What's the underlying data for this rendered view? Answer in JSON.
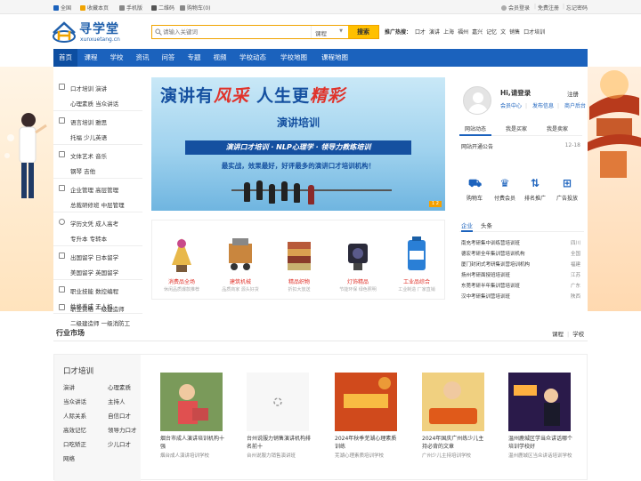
{
  "topbar": {
    "left": [
      "全国",
      "收藏本页",
      "手机版",
      "二维码",
      "购物车(0)"
    ],
    "right": [
      "会员登录",
      "免费注册",
      "忘记密码"
    ]
  },
  "logo": {
    "name": "寻学堂",
    "domain": "xunxuetang.cn"
  },
  "search": {
    "placeholder": "请输入关键词",
    "scope": "课程",
    "button": "搜索"
  },
  "hot": {
    "label": "推广热搜：",
    "items": [
      "口才",
      "演讲",
      "上海",
      "福州",
      "嘉兴",
      "记忆",
      "文",
      "销售",
      "口才培训"
    ]
  },
  "nav": [
    "首页",
    "课程",
    "学校",
    "资讯",
    "问答",
    "专题",
    "视频",
    "学校动态",
    "学校地图",
    "课程地图"
  ],
  "categories": [
    {
      "l1": "口才培训 演讲",
      "l2": "心理素质 当众讲话"
    },
    {
      "l1": "语言培训 雅思",
      "l2": "托福 少儿英语"
    },
    {
      "l1": "文体艺术 音乐",
      "l2": "钢琴 吉他"
    },
    {
      "l1": "企业管理 高层管理",
      "l2": "总裁研修班 中层管理"
    },
    {
      "l1": "学历文凭 成人高考",
      "l2": "专升本 专转本"
    },
    {
      "l1": "出国留学 日本留学",
      "l2": "美国留学 英国留学"
    },
    {
      "l1": "职业技能 数控编程",
      "l2": "性格养成 无人机"
    },
    {
      "l1": "职业资格 一级建造师",
      "l2": "二级建造师 一级消防工"
    }
  ],
  "banner": {
    "title_a": "演讲有",
    "title_b": "风采",
    "title_c": "人生更",
    "title_d": "精彩",
    "subtitle": "演讲培训",
    "strip": "演讲口才培训 · NLP心理学 · 领导力教练培训",
    "line": "最实战，效果最好，好评最多的演讲口才培训机构！",
    "pager": "1 2"
  },
  "ads": [
    {
      "title": "消费品全场",
      "sub": "休闲品质爆款推荐",
      "color": "#e8b84a"
    },
    {
      "title": "建筑机械",
      "sub": "品质商家 源头好货",
      "color": "#c9863e"
    },
    {
      "title": "精品织物",
      "sub": "折扣大放送",
      "color": "#b85a3a"
    },
    {
      "title": "灯饰精品",
      "sub": "节能环保 绿色照明",
      "color": "#2a2a3a"
    },
    {
      "title": "工业品综合",
      "sub": "工业制造 厂家直销",
      "color": "#2a7fd6"
    }
  ],
  "user": {
    "greet": "Hi,请登录",
    "register": "注册",
    "links": [
      "会员中心",
      "发布信息",
      "商户后台"
    ],
    "tabs": [
      "网站动态",
      "我是买家",
      "我是卖家"
    ],
    "notice": {
      "text": "网站开通公告",
      "date": "12-18"
    },
    "icons": [
      {
        "label": "购物车",
        "icon": "cart-icon",
        "glyph": "⛟"
      },
      {
        "label": "付费会员",
        "icon": "vip-icon",
        "glyph": "♛"
      },
      {
        "label": "排名推广",
        "icon": "rank-icon",
        "glyph": "⇅"
      },
      {
        "label": "广告投放",
        "icon": "ad-icon",
        "glyph": "⊞"
      }
    ]
  },
  "news": {
    "tabs": [
      "企业",
      "头条"
    ],
    "rows": [
      {
        "name": "南充考研集中训练营培训班",
        "region": "四川"
      },
      {
        "name": "德宏考研全年集训营培训机构",
        "region": "全国"
      },
      {
        "name": "厦门封闭式考研集训营培训机构",
        "region": "福建"
      },
      {
        "name": "扬州考研面授班培训班",
        "region": "江苏"
      },
      {
        "name": "东莞考研半年集训营培训班",
        "region": "广东"
      },
      {
        "name": "汉中考研集训营培训班",
        "region": "陕西"
      }
    ]
  },
  "market": {
    "title": "行业市场",
    "links": [
      "课程",
      "学校"
    ],
    "left_title": "口才培训",
    "keywords": [
      "演讲",
      "心理素质",
      "当众讲话",
      "主持人",
      "人际关系",
      "自信口才",
      "高效记忆",
      "领导力口才",
      "口吃矫正",
      "少儿口才",
      "网络"
    ],
    "cards": [
      {
        "title": "烟台市成人演讲培训机构十强",
        "school": "烟台成人演讲培训学校",
        "color": "#7a9a5a"
      },
      {
        "title": "台州说服力销售演讲机构排名前十",
        "school": "台州说服力销售演讲班",
        "color": "#f2f2f2"
      },
      {
        "title": "2024年秋季芜湖心理素质训练",
        "school": "芜湖心理素质培训学校",
        "color": "#d04a1c"
      },
      {
        "title": "2024年国庆广州练少儿主持必背的文章",
        "school": "广州少儿主持培训学校",
        "color": "#e2a040"
      },
      {
        "title": "温州鹿城区学当众讲话哪个培训学校好",
        "school": "温州鹿城区当众讲话培训学校",
        "color": "#3a2a5a"
      }
    ]
  }
}
